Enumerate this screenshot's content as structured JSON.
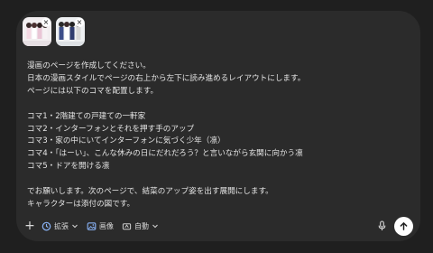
{
  "attachments": [
    {
      "name": "character-image-1",
      "remove_glyph": "×"
    },
    {
      "name": "character-image-2",
      "remove_glyph": "×"
    }
  ],
  "message": {
    "lines": [
      "漫画のページを作成してください。",
      "日本の漫画スタイルでページの右上から左下に読み進めるレイアウトにします。",
      "ページには以下のコマを配置します。",
      "",
      "コマ1・2階建ての戸建ての一軒家",
      "コマ2・インターフォンとそれを押す手のアップ",
      "コマ3・家の中にいてインターフォンに気づく少年（凛）",
      "コマ4・「はーい」、こんな休みの日にだれだろう？と言いながら玄関に向かう凛",
      "コマ5・ドアを開ける凛",
      "",
      "でお願いします。次のページで、結菜のアップ姿を出す展開にします。",
      "キャラクターは添付の図です。"
    ]
  },
  "toolbar": {
    "add_glyph": "+",
    "extend_label": "拡張",
    "image_label": "画像",
    "auto_label": "自動"
  },
  "colors": {
    "background": "#1f1f1f",
    "card": "#2b2b2b",
    "accent_blue": "#8ab4f8",
    "text": "#e3e3e3"
  }
}
